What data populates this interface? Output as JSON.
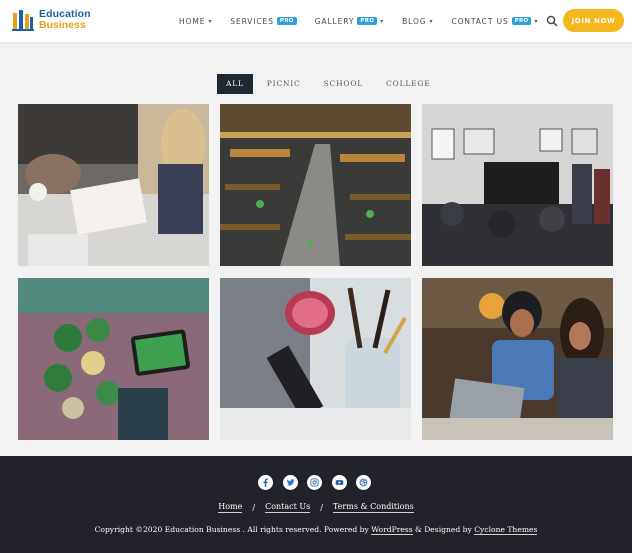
{
  "brand": {
    "line1": "Education",
    "line2": "Business"
  },
  "nav": {
    "home": "HOME",
    "services": "SERVICES",
    "gallery": "GALLERY",
    "blog": "BLOG",
    "contact": "CONTACT US",
    "badge": "PRO",
    "join": "JOIN NOW"
  },
  "filters": [
    "ALL",
    "PICNIC",
    "SCHOOL",
    "COLLEGE"
  ],
  "footer": {
    "links": [
      "Home",
      "Contact Us",
      "Terms & Conditions"
    ],
    "separator": "/",
    "copyright_prefix": "Copyright ©2020 Education Business . All rights reserved. Powered by ",
    "wordpress": "WordPress",
    "designed_by": " & Designed by ",
    "cyclone": "Cyclone Themes"
  },
  "colors": {
    "accent": "#f4b81e",
    "badge": "#2f9fd8",
    "footer": "#22222a",
    "active_tab": "#1f2933"
  },
  "icons": [
    "facebook-icon",
    "twitter-icon",
    "instagram-icon",
    "youtube-icon",
    "dribbble-icon"
  ]
}
